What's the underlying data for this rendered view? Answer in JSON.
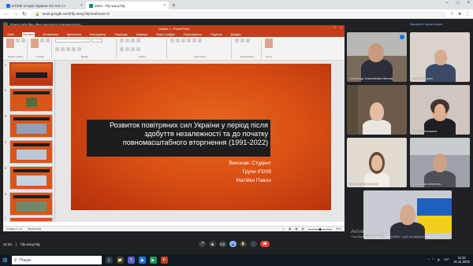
{
  "browser": {
    "tabs": [
      {
        "title": "ЕТ200 Історія України XX-XXI ст.",
        "color": "#1a73e8",
        "active": false
      },
      {
        "title": "Meet - hfy-wouj-hlq",
        "color": "#00897b",
        "active": true
      }
    ],
    "url": "meet.google.com/hfy-wouj-hlq?authuser=0"
  },
  "meet": {
    "presenter_label": "Павло Матійко (Ви показуєте презентацію)",
    "share_note": "Зупинити презентацію",
    "time": "11:34",
    "meeting_code": "hfy-wouj-hlq"
  },
  "ppt": {
    "window_title": "Освіта 1 - PowerPoint",
    "tabs": [
      "Файл",
      "Основне",
      "Вставлення",
      "Креслення",
      "Конструктор",
      "Переходи",
      "Анімація",
      "Показ слайдів",
      "Рецензування",
      "Подання",
      "Довідка"
    ],
    "active_tab": "Основне",
    "ribbon_groups": [
      "Буфер обміну",
      "Слайди",
      "Шрифт",
      "Абзац",
      "Креслення",
      "Редагування",
      "Голос"
    ],
    "slide_count_label": "Слайд 1 з 11",
    "language_label": "Українська",
    "zoom_label": "90%",
    "thumb_numbers": [
      "1",
      "2",
      "3",
      "4",
      "5",
      "6",
      "7"
    ]
  },
  "slide": {
    "title": "Розвиток повітряних сил України у період після здобуття незалежності та до початку повномасштабного вторгнення (1991-2022)",
    "author_lines": [
      "Виконав: Студент",
      "Групи ІП20б",
      "Матійко Павло"
    ]
  },
  "participants": [
    {
      "name": "Олександр Анатолійович Жиглов"
    },
    {
      "name": "Олег Петрашин"
    },
    {
      "name": ""
    },
    {
      "name": "Наталія Волошина"
    },
    {
      "name": "Оксана Солотвиньска"
    },
    {
      "name": "Володимир Шевченко"
    },
    {
      "name": "Павло Матійко"
    }
  ],
  "watermark": {
    "line1": "Актив...",
    "line2": "Перейдіть до розділу \"Настройки\", щоб активувати Windows."
  },
  "taskbar": {
    "search_placeholder": "Пошук",
    "time": "11:34",
    "date": "21.11.2022",
    "lang": "УКР"
  }
}
